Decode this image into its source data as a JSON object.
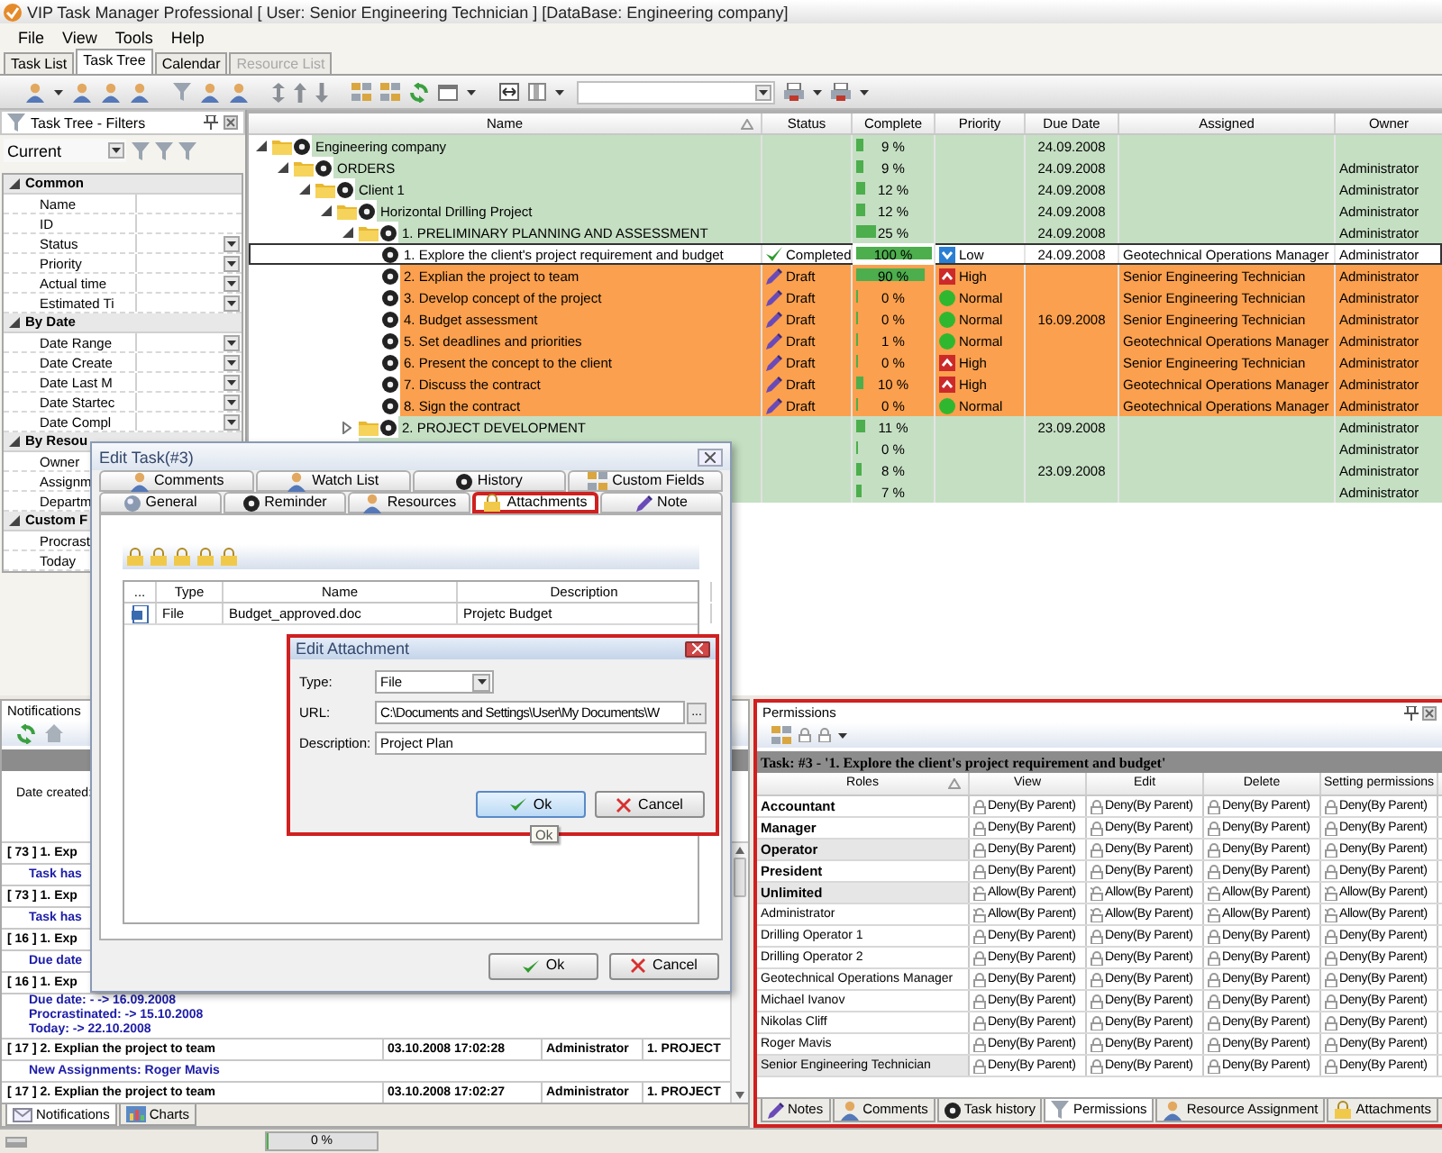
{
  "window": {
    "title": "VIP Task Manager Professional [ User: Senior Engineering Technician ] [DataBase: Engineering company]"
  },
  "menu": [
    "File",
    "View",
    "Tools",
    "Help"
  ],
  "view_tabs": [
    {
      "label": "Task List",
      "selected": false,
      "disabled": false
    },
    {
      "label": "Task Tree",
      "selected": true,
      "disabled": false
    },
    {
      "label": "Calendar",
      "selected": false,
      "disabled": false
    },
    {
      "label": "Resource List",
      "selected": false,
      "disabled": true
    }
  ],
  "filters": {
    "title": "Task Tree - Filters",
    "preset": "Current",
    "groups": [
      {
        "label": "Common",
        "expanded": true,
        "children": [
          {
            "label": "Name",
            "dropdown": false
          },
          {
            "label": "ID",
            "dropdown": false
          },
          {
            "label": "Status",
            "dropdown": true
          },
          {
            "label": "Priority",
            "dropdown": true
          },
          {
            "label": "Actual time",
            "dropdown": true
          },
          {
            "label": "Estimated Ti",
            "dropdown": true
          }
        ]
      },
      {
        "label": "By Date",
        "expanded": true,
        "children": [
          {
            "label": "Date Range",
            "dropdown": true
          },
          {
            "label": "Date Create",
            "dropdown": true
          },
          {
            "label": "Date Last M",
            "dropdown": true
          },
          {
            "label": "Date Startec",
            "dropdown": true
          },
          {
            "label": "Date Compl",
            "dropdown": true
          }
        ]
      },
      {
        "label": "By Resou",
        "expanded": true,
        "children": [
          {
            "label": "Owner",
            "dropdown": false
          },
          {
            "label": "Assignm",
            "dropdown": false
          },
          {
            "label": "Departm",
            "dropdown": false
          }
        ]
      },
      {
        "label": "Custom F",
        "expanded": true,
        "children": [
          {
            "label": "Procrast",
            "dropdown": false
          },
          {
            "label": "Today",
            "dropdown": false
          }
        ]
      }
    ]
  },
  "task_tree": {
    "columns": [
      {
        "label": "Name",
        "sorted": true
      },
      {
        "label": "Status",
        "sorted": false
      },
      {
        "label": "Complete",
        "sorted": false
      },
      {
        "label": "Priority",
        "sorted": false
      },
      {
        "label": "Due Date",
        "sorted": false
      },
      {
        "label": "Assigned",
        "sorted": false
      },
      {
        "label": "Owner",
        "sorted": false
      }
    ],
    "rows": [
      {
        "name": "Engineering company",
        "kind": "group",
        "selected": false,
        "expanded": true,
        "complete": "9 %",
        "level": 0.09,
        "due_date": "24.09.2008",
        "children": [
          {
            "name": "ORDERS",
            "kind": "group",
            "selected": false,
            "expanded": true,
            "complete": "9 %",
            "level": 0.09,
            "due_date": "24.09.2008",
            "owner": "Administrator",
            "children": [
              {
                "name": "Client 1",
                "kind": "group",
                "selected": false,
                "expanded": true,
                "complete": "12 %",
                "level": 0.12,
                "due_date": "24.09.2008",
                "owner": "Administrator",
                "children": [
                  {
                    "name": "Horizontal Drilling Project",
                    "kind": "group",
                    "selected": false,
                    "expanded": true,
                    "complete": "12 %",
                    "level": 0.12,
                    "due_date": "24.09.2008",
                    "owner": "Administrator",
                    "children": [
                      {
                        "name": "1. PRELIMINARY PLANNING AND ASSESSMENT",
                        "kind": "group",
                        "selected": false,
                        "expanded": true,
                        "complete": "25 %",
                        "level": 0.25,
                        "due_date": "24.09.2008",
                        "owner": "Administrator",
                        "children": [
                          {
                            "name": "1. Explore the client's project requirement and budget",
                            "kind": "task",
                            "selected": true,
                            "status": {
                              "text": "Completed",
                              "kind": "check"
                            },
                            "complete": "100 %",
                            "level": 1,
                            "priority": {
                              "text": "Low",
                              "kind": "low"
                            },
                            "due_date": "24.09.2008",
                            "assigned": "Geotechnical Operations Manager",
                            "owner": "Administrator"
                          },
                          {
                            "name": "2. Explian the project to team",
                            "kind": "task",
                            "selected": false,
                            "status": {
                              "text": "Draft",
                              "kind": "draft"
                            },
                            "complete": "90 %",
                            "level": 0.9,
                            "priority": {
                              "text": "High",
                              "kind": "high"
                            },
                            "assigned": "Senior Engineering Technician",
                            "owner": "Administrator"
                          },
                          {
                            "name": "3. Develop concept of the project",
                            "kind": "task",
                            "selected": false,
                            "status": {
                              "text": "Draft",
                              "kind": "draft"
                            },
                            "complete": "0 %",
                            "level": 0,
                            "priority": {
                              "text": "Normal",
                              "kind": "normal"
                            },
                            "assigned": "Senior Engineering Technician",
                            "owner": "Administrator"
                          },
                          {
                            "name": "4. Budget assessment",
                            "kind": "task",
                            "selected": false,
                            "status": {
                              "text": "Draft",
                              "kind": "draft"
                            },
                            "complete": "0 %",
                            "level": 0,
                            "priority": {
                              "text": "Normal",
                              "kind": "normal"
                            },
                            "due_date": "16.09.2008",
                            "assigned": "Senior Engineering Technician",
                            "owner": "Administrator"
                          },
                          {
                            "name": "5. Set deadlines and priorities",
                            "kind": "task",
                            "selected": false,
                            "status": {
                              "text": "Draft",
                              "kind": "draft"
                            },
                            "complete": "1 %",
                            "level": 0.01,
                            "priority": {
                              "text": "Normal",
                              "kind": "normal"
                            },
                            "assigned": "Geotechnical Operations Manager",
                            "owner": "Administrator"
                          },
                          {
                            "name": "6. Present the concept to the client",
                            "kind": "task",
                            "selected": false,
                            "status": {
                              "text": "Draft",
                              "kind": "draft"
                            },
                            "complete": "0 %",
                            "level": 0,
                            "priority": {
                              "text": "High",
                              "kind": "high"
                            },
                            "assigned": "Senior Engineering Technician",
                            "owner": "Administrator"
                          },
                          {
                            "name": "7. Discuss the contract",
                            "kind": "task",
                            "selected": false,
                            "status": {
                              "text": "Draft",
                              "kind": "draft"
                            },
                            "complete": "10 %",
                            "level": 0.1,
                            "priority": {
                              "text": "High",
                              "kind": "high"
                            },
                            "assigned": "Geotechnical Operations Manager",
                            "owner": "Administrator"
                          },
                          {
                            "name": "8. Sign the contract",
                            "kind": "task",
                            "selected": false,
                            "status": {
                              "text": "Draft",
                              "kind": "draft"
                            },
                            "complete": "0 %",
                            "level": 0,
                            "priority": {
                              "text": "Normal",
                              "kind": "normal"
                            },
                            "assigned": "Geotechnical Operations Manager",
                            "owner": "Administrator"
                          }
                        ]
                      },
                      {
                        "name": "2. PROJECT DEVELOPMENT",
                        "kind": "group",
                        "selected": false,
                        "expanded": false,
                        "complete": "11 %",
                        "level": 0.11,
                        "due_date": "23.09.2008",
                        "owner": "Administrator"
                      },
                      {
                        "kind": "group",
                        "selected": false,
                        "complete": "0 %",
                        "level": 0,
                        "owner": "Administrator"
                      },
                      {
                        "kind": "group",
                        "selected": false,
                        "complete": "8 %",
                        "level": 0.08,
                        "due_date": "23.09.2008",
                        "owner": "Administrator"
                      },
                      {
                        "kind": "group",
                        "selected": false,
                        "complete": "7 %",
                        "level": 0.07,
                        "owner": "Administrator"
                      }
                    ]
                  }
                ]
              }
            ]
          }
        ]
      }
    ]
  },
  "notifications": {
    "title": "Notifications",
    "filter_label": "Date created:",
    "entries": [
      {
        "kind": "event",
        "title": "[ 73 ] 1. Exp"
      },
      {
        "kind": "detail",
        "lines": [
          "Task has"
        ]
      },
      {
        "kind": "event",
        "title": "[ 73 ] 1. Exp"
      },
      {
        "kind": "detail",
        "lines": [
          "Task has"
        ]
      },
      {
        "kind": "event",
        "title": "[ 16 ] 1. Exp"
      },
      {
        "kind": "detail",
        "lines": [
          "Due date"
        ]
      },
      {
        "kind": "event",
        "title": "[ 16 ] 1. Exp"
      },
      {
        "kind": "detail",
        "lines": [
          "Due date: - -> 16.09.2008",
          "Procrastinated:  -> 15.10.2008",
          "Today:  -> 22.10.2008"
        ]
      },
      {
        "kind": "event",
        "title": "[ 17 ] 2. Explian the project to team",
        "date": "03.10.2008 17:02:28",
        "author": "Administrator",
        "project": "1. PROJECT"
      },
      {
        "kind": "detail",
        "lines": [
          "New Assignments: Roger Mavis"
        ]
      },
      {
        "kind": "event",
        "title": "[ 17 ] 2. Explian the project to team",
        "date": "03.10.2008 17:02:27",
        "author": "Administrator",
        "project": "1. PROJECT"
      }
    ],
    "tabs": [
      {
        "label": "Notifications",
        "selected": true
      },
      {
        "label": "Charts",
        "selected": false
      }
    ]
  },
  "permissions": {
    "title": "Permissions",
    "highlighted": true,
    "task_caption": "Task: #3 - '1. Explore the client's project requirement and budget'",
    "columns": [
      {
        "label": "Roles",
        "sorted": true
      },
      {
        "label": "View",
        "sorted": false
      },
      {
        "label": "Edit",
        "sorted": false
      },
      {
        "label": "Delete",
        "sorted": false
      },
      {
        "label": "Setting permissions",
        "sorted": false
      }
    ],
    "rows": [
      {
        "kind": "group",
        "shaded": false,
        "cells": [
          {
            "text": "Accountant"
          },
          {
            "text": "Deny(By Parent)",
            "kind": "deny"
          },
          {
            "text": "Deny(By Parent)",
            "kind": "deny"
          },
          {
            "text": "Deny(By Parent)",
            "kind": "deny"
          },
          {
            "text": "Deny(By Parent)",
            "kind": "deny"
          }
        ]
      },
      {
        "kind": "group",
        "shaded": false,
        "cells": [
          {
            "text": "Manager"
          },
          {
            "text": "Deny(By Parent)",
            "kind": "deny"
          },
          {
            "text": "Deny(By Parent)",
            "kind": "deny"
          },
          {
            "text": "Deny(By Parent)",
            "kind": "deny"
          },
          {
            "text": "Deny(By Parent)",
            "kind": "deny"
          }
        ]
      },
      {
        "kind": "group",
        "shaded": true,
        "cells": [
          {
            "text": "Operator"
          },
          {
            "text": "Deny(By Parent)",
            "kind": "deny"
          },
          {
            "text": "Deny(By Parent)",
            "kind": "deny"
          },
          {
            "text": "Deny(By Parent)",
            "kind": "deny"
          },
          {
            "text": "Deny(By Parent)",
            "kind": "deny"
          }
        ]
      },
      {
        "kind": "group",
        "shaded": false,
        "cells": [
          {
            "text": "President"
          },
          {
            "text": "Deny(By Parent)",
            "kind": "deny"
          },
          {
            "text": "Deny(By Parent)",
            "kind": "deny"
          },
          {
            "text": "Deny(By Parent)",
            "kind": "deny"
          },
          {
            "text": "Deny(By Parent)",
            "kind": "deny"
          }
        ]
      },
      {
        "kind": "group",
        "shaded": true,
        "cells": [
          {
            "text": "Unlimited"
          },
          {
            "text": "Allow(By Parent)",
            "kind": "allow"
          },
          {
            "text": "Allow(By Parent)",
            "kind": "allow"
          },
          {
            "text": "Allow(By Parent)",
            "kind": "allow"
          },
          {
            "text": "Allow(By Parent)",
            "kind": "allow"
          }
        ]
      },
      {
        "kind": "user",
        "shaded": false,
        "cells": [
          {
            "text": "Administrator"
          },
          {
            "text": "Allow(By Parent)",
            "kind": "allow"
          },
          {
            "text": "Allow(By Parent)",
            "kind": "allow"
          },
          {
            "text": "Allow(By Parent)",
            "kind": "allow"
          },
          {
            "text": "Allow(By Parent)",
            "kind": "allow"
          }
        ]
      },
      {
        "kind": "user",
        "shaded": false,
        "cells": [
          {
            "text": "Drilling Operator 1"
          },
          {
            "text": "Deny(By Parent)",
            "kind": "deny"
          },
          {
            "text": "Deny(By Parent)",
            "kind": "deny"
          },
          {
            "text": "Deny(By Parent)",
            "kind": "deny"
          },
          {
            "text": "Deny(By Parent)",
            "kind": "deny"
          }
        ]
      },
      {
        "kind": "user",
        "shaded": false,
        "cells": [
          {
            "text": "Drilling Operator 2"
          },
          {
            "text": "Deny(By Parent)",
            "kind": "deny"
          },
          {
            "text": "Deny(By Parent)",
            "kind": "deny"
          },
          {
            "text": "Deny(By Parent)",
            "kind": "deny"
          },
          {
            "text": "Deny(By Parent)",
            "kind": "deny"
          }
        ]
      },
      {
        "kind": "user",
        "shaded": false,
        "cells": [
          {
            "text": "Geotechnical Operations Manager"
          },
          {
            "text": "Deny(By Parent)",
            "kind": "deny"
          },
          {
            "text": "Deny(By Parent)",
            "kind": "deny"
          },
          {
            "text": "Deny(By Parent)",
            "kind": "deny"
          },
          {
            "text": "Deny(By Parent)",
            "kind": "deny"
          }
        ]
      },
      {
        "kind": "user",
        "shaded": false,
        "cells": [
          {
            "text": "Michael Ivanov"
          },
          {
            "text": "Deny(By Parent)",
            "kind": "deny"
          },
          {
            "text": "Deny(By Parent)",
            "kind": "deny"
          },
          {
            "text": "Deny(By Parent)",
            "kind": "deny"
          },
          {
            "text": "Deny(By Parent)",
            "kind": "deny"
          }
        ]
      },
      {
        "kind": "user",
        "shaded": false,
        "cells": [
          {
            "text": "Nikolas Cliff"
          },
          {
            "text": "Deny(By Parent)",
            "kind": "deny"
          },
          {
            "text": "Deny(By Parent)",
            "kind": "deny"
          },
          {
            "text": "Deny(By Parent)",
            "kind": "deny"
          },
          {
            "text": "Deny(By Parent)",
            "kind": "deny"
          }
        ]
      },
      {
        "kind": "user",
        "shaded": false,
        "cells": [
          {
            "text": "Roger Mavis"
          },
          {
            "text": "Deny(By Parent)",
            "kind": "deny"
          },
          {
            "text": "Deny(By Parent)",
            "kind": "deny"
          },
          {
            "text": "Deny(By Parent)",
            "kind": "deny"
          },
          {
            "text": "Deny(By Parent)",
            "kind": "deny"
          }
        ]
      },
      {
        "kind": "user",
        "shaded": true,
        "cells": [
          {
            "text": "Senior Engineering Technician"
          },
          {
            "text": "Deny(By Parent)",
            "kind": "deny"
          },
          {
            "text": "Deny(By Parent)",
            "kind": "deny"
          },
          {
            "text": "Deny(By Parent)",
            "kind": "deny"
          },
          {
            "text": "Deny(By Parent)",
            "kind": "deny"
          }
        ]
      }
    ],
    "tabs": [
      {
        "label": "Notes",
        "selected": false
      },
      {
        "label": "Comments",
        "selected": false
      },
      {
        "label": "Task history",
        "selected": false
      },
      {
        "label": "Permissions",
        "selected": true
      },
      {
        "label": "Resource Assignment",
        "selected": false
      },
      {
        "label": "Attachments",
        "selected": false
      }
    ]
  },
  "status_bar": {
    "progress": {
      "text": "0 %",
      "level": 0
    }
  },
  "edit_task": {
    "title": "Edit Task(#3)",
    "tab_rows": [
      [
        {
          "label": "Comments",
          "selected": false,
          "highlighted": false
        },
        {
          "label": "Watch List",
          "selected": false,
          "highlighted": false
        },
        {
          "label": "History",
          "selected": false,
          "highlighted": false
        },
        {
          "label": "Custom Fields",
          "selected": false,
          "highlighted": false
        }
      ],
      [
        {
          "label": "General",
          "selected": false,
          "highlighted": false
        },
        {
          "label": "Reminder",
          "selected": false,
          "highlighted": false
        },
        {
          "label": "Resources",
          "selected": false,
          "highlighted": false
        },
        {
          "label": "Attachments",
          "selected": true,
          "highlighted": true
        },
        {
          "label": "Note",
          "selected": false,
          "highlighted": false
        }
      ]
    ],
    "attachments": {
      "columns": [
        "...",
        "Type",
        "Name",
        "Description"
      ],
      "rows": [
        {
          "type": "File",
          "name": "Budget_approved.doc",
          "description": "Projetc Budget"
        }
      ]
    },
    "buttons": [
      {
        "label": "Ok",
        "kind": "ok"
      },
      {
        "label": "Cancel",
        "kind": "cancel"
      }
    ]
  },
  "edit_attachment": {
    "title": "Edit Attachment",
    "highlighted": true,
    "fields": [
      {
        "label": "Type:",
        "kind": "select",
        "value": "File"
      },
      {
        "label": "URL:",
        "kind": "browse",
        "value": "C:\\Documents and Settings\\User\\My Documents\\W",
        "browse_label": "..."
      },
      {
        "label": "Description:",
        "kind": "text",
        "value": "Project Plan"
      }
    ],
    "buttons": [
      {
        "label": "Ok",
        "kind": "ok",
        "focused": true
      },
      {
        "label": "Cancel",
        "kind": "cancel",
        "focused": false
      }
    ],
    "tooltip": "Ok"
  }
}
